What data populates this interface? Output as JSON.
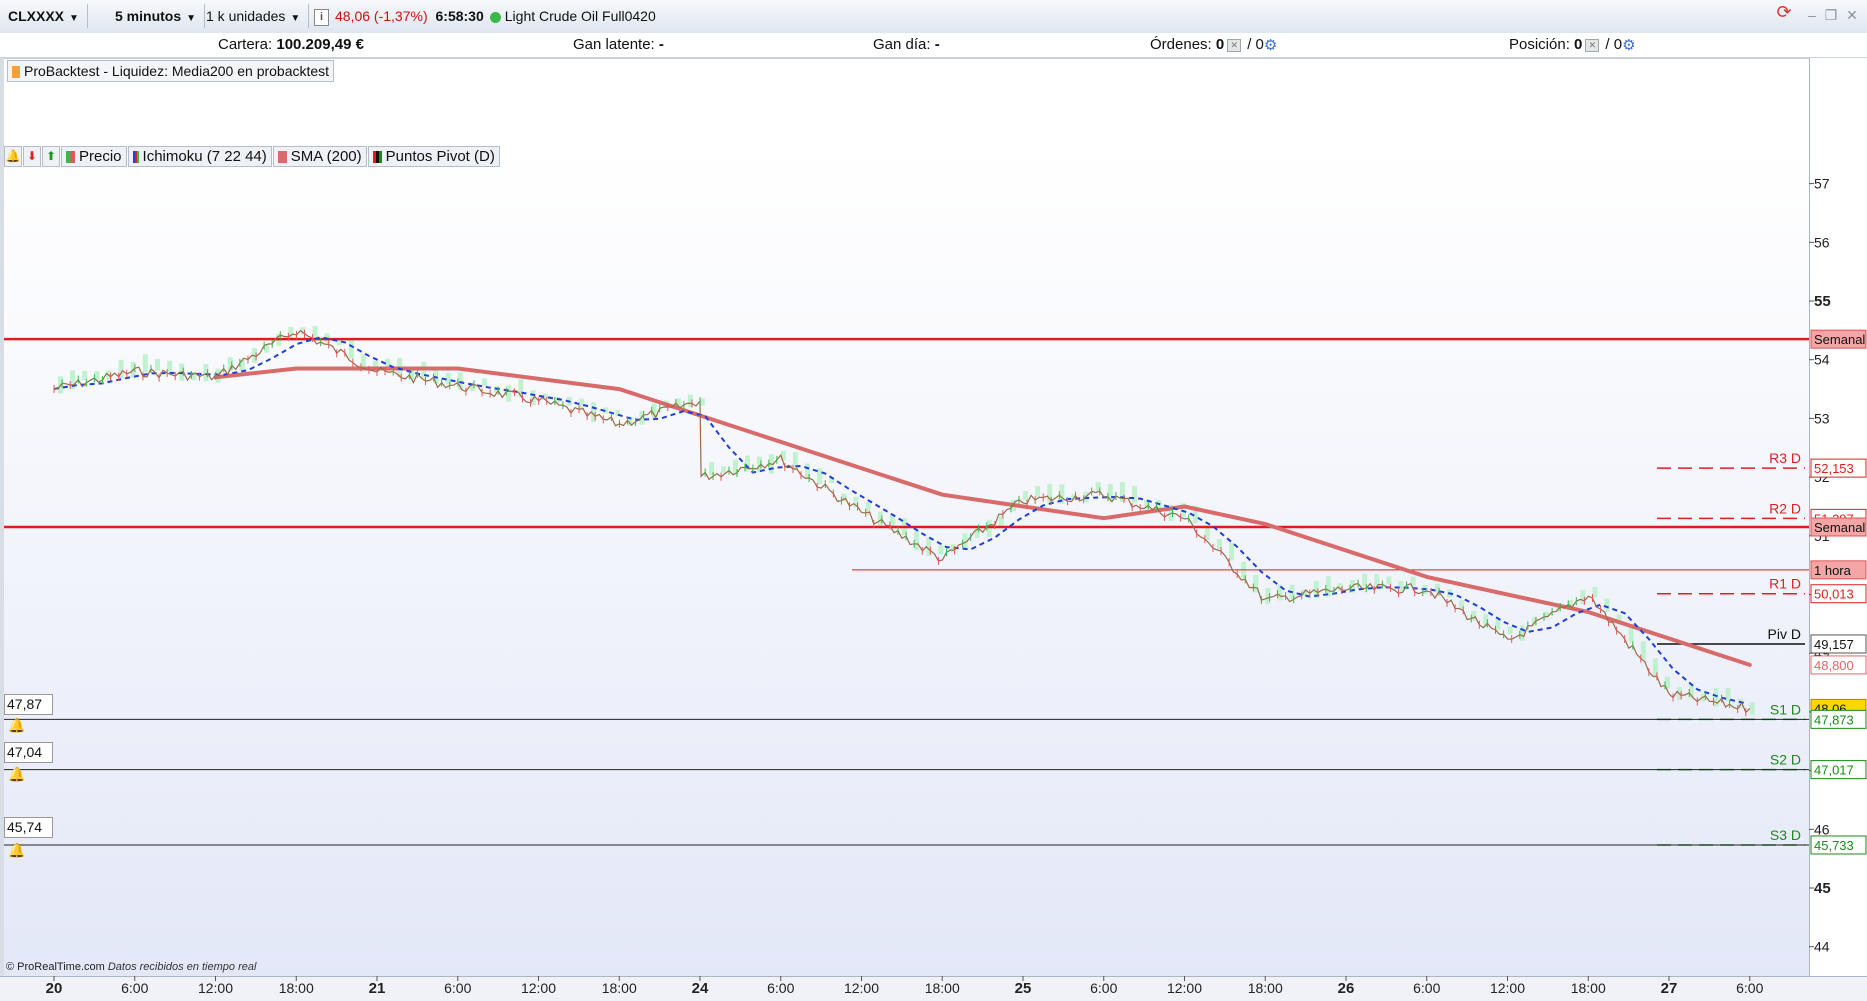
{
  "toolbar": {
    "symbol": "CLXXXX",
    "timeframe": "5 minutos",
    "units": "1 k unidades",
    "price_change": "48,06 (-1,37%)",
    "time": "6:58:30",
    "instrument": "Light Crude Oil Full0420",
    "change_color": "#cc1111"
  },
  "account": {
    "cartera_label": "Cartera:",
    "cartera_value": "100.209,49 €",
    "gan_latente_label": "Gan latente:",
    "gan_latente_value": "-",
    "gan_dia_label": "Gan día:",
    "gan_dia_value": "-",
    "ordenes_label": "Órdenes:",
    "ordenes_value": "0",
    "ordenes_value2": "/ 0",
    "posicion_label": "Posición:",
    "posicion_value": "0",
    "posicion_value2": "/ 0"
  },
  "backtest_panel": {
    "label": "ProBacktest - Liquidez: Media200 en probacktest"
  },
  "legend": {
    "precio": "Precio",
    "ichimoku": "Ichimoku (7 22 44)",
    "sma": "SMA (200)",
    "pivot": "Puntos Pivot (D)"
  },
  "alerts": [
    {
      "label": "47,87"
    },
    {
      "label": "47,04"
    },
    {
      "label": "45,74"
    }
  ],
  "footer": {
    "copyright": "© ProRealTime.com",
    "realtime": "Datos recibidos en tiempo real"
  },
  "colors": {
    "sma": "#d96a6a",
    "weekly_line": "#e31b1b",
    "cloud": "#b8f0c8",
    "kijun": "#1f3fd6",
    "pivot_resistance": "#e02020",
    "pivot_support": "#1a8a1a",
    "price_tag_bg": "#ffd700"
  },
  "chart_data": {
    "type": "line",
    "y_axis_ticks": [
      "57",
      "56",
      "55",
      "54",
      "53",
      "52",
      "51",
      "50",
      "49",
      "48",
      "47",
      "46",
      "45",
      "44"
    ],
    "x_tick_labels": [
      "20",
      "6:00",
      "12:00",
      "18:00",
      "21",
      "6:00",
      "12:00",
      "18:00",
      "24",
      "6:00",
      "12:00",
      "18:00",
      "25",
      "6:00",
      "12:00",
      "18:00",
      "26",
      "6:00",
      "12:00",
      "18:00",
      "27",
      "6:00"
    ],
    "price_series_approx": [
      {
        "x": "20 0:00",
        "y": 53.5
      },
      {
        "x": "20 6:00",
        "y": 53.8
      },
      {
        "x": "20 12:00",
        "y": 53.7
      },
      {
        "x": "20 18:00",
        "y": 54.5
      },
      {
        "x": "21 0:00",
        "y": 53.8
      },
      {
        "x": "21 12:00",
        "y": 53.3
      },
      {
        "x": "21 18:00",
        "y": 52.9
      },
      {
        "x": "24 0:00",
        "y": 53.3
      },
      {
        "x": "24 0:05",
        "y": 52.0
      },
      {
        "x": "24 6:00",
        "y": 52.3
      },
      {
        "x": "24 12:00",
        "y": 51.4
      },
      {
        "x": "24 18:00",
        "y": 50.6
      },
      {
        "x": "25 0:00",
        "y": 51.6
      },
      {
        "x": "25 6:00",
        "y": 51.7
      },
      {
        "x": "25 12:00",
        "y": 51.3
      },
      {
        "x": "25 18:00",
        "y": 49.9
      },
      {
        "x": "26 0:00",
        "y": 50.1
      },
      {
        "x": "26 6:00",
        "y": 50.1
      },
      {
        "x": "26 12:00",
        "y": 49.2
      },
      {
        "x": "26 18:00",
        "y": 50.0
      },
      {
        "x": "27 0:00",
        "y": 48.3
      },
      {
        "x": "27 6:00",
        "y": 48.06
      }
    ],
    "sma200_approx": [
      {
        "x": "20 12:00",
        "y": 53.7
      },
      {
        "x": "20 18:00",
        "y": 53.85
      },
      {
        "x": "21 6:00",
        "y": 53.85
      },
      {
        "x": "21 18:00",
        "y": 53.5
      },
      {
        "x": "24 6:00",
        "y": 52.6
      },
      {
        "x": "24 18:00",
        "y": 51.7
      },
      {
        "x": "25 6:00",
        "y": 51.3
      },
      {
        "x": "25 12:00",
        "y": 51.5
      },
      {
        "x": "25 18:00",
        "y": 51.2
      },
      {
        "x": "26 6:00",
        "y": 50.3
      },
      {
        "x": "26 18:00",
        "y": 49.7
      },
      {
        "x": "27 6:00",
        "y": 48.8
      }
    ],
    "horizontal_levels": [
      {
        "label": "Semanal",
        "value": 54.35
      },
      {
        "label": "Semanal",
        "value": 51.15
      },
      {
        "label": "1 hora",
        "value": 50.42
      },
      {
        "label": "R3 D",
        "value": 52.153
      },
      {
        "label": "R2 D",
        "value": 51.297
      },
      {
        "label": "R1 D",
        "value": 50.013
      },
      {
        "label": "Piv D",
        "value": 49.157
      },
      {
        "label": "S1 D",
        "value": 47.873
      },
      {
        "label": "S2 D",
        "value": 47.017
      },
      {
        "label": "S3 D",
        "value": 45.733
      }
    ],
    "scale_tags": [
      {
        "text": "Semanal",
        "value": 54.35,
        "kind": "weekly"
      },
      {
        "text": "52,153",
        "value": 52.153,
        "kind": "res"
      },
      {
        "text": "51,297",
        "value": 51.297,
        "kind": "res"
      },
      {
        "text": "Semanal",
        "value": 51.15,
        "kind": "weekly"
      },
      {
        "text": "1 hora",
        "value": 50.42,
        "kind": "weekly"
      },
      {
        "text": "50,013",
        "value": 50.013,
        "kind": "res"
      },
      {
        "text": "49,157",
        "value": 49.157,
        "kind": "piv"
      },
      {
        "text": "48,800",
        "value": 48.8,
        "kind": "sma"
      },
      {
        "text": "48,06",
        "value": 48.06,
        "kind": "price"
      },
      {
        "text": "47,873",
        "value": 47.873,
        "kind": "sup"
      },
      {
        "text": "47,017",
        "value": 47.017,
        "kind": "sup"
      },
      {
        "text": "45,733",
        "value": 45.733,
        "kind": "sup"
      }
    ],
    "last_price": "48,06"
  }
}
